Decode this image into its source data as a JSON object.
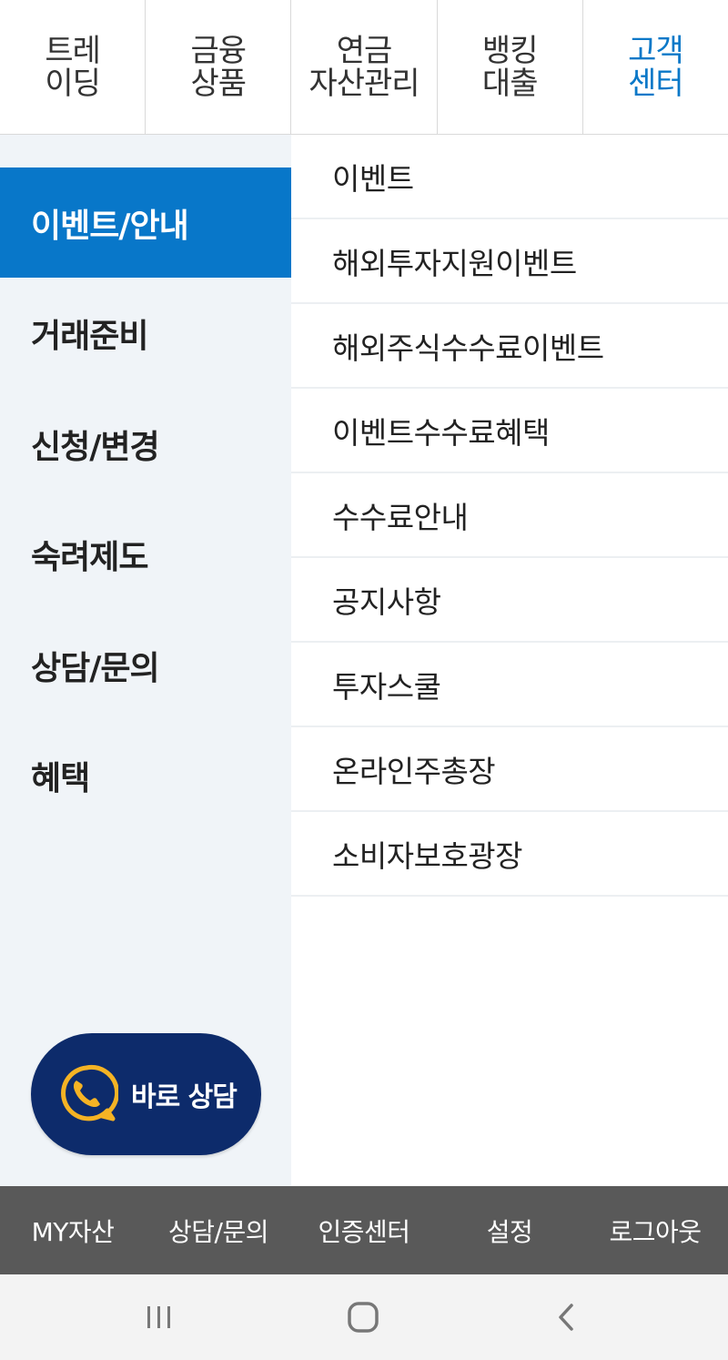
{
  "top_tabs": [
    {
      "line1": "트레",
      "line2": "이딩"
    },
    {
      "line1": "금융",
      "line2": "상품"
    },
    {
      "line1": "연금",
      "line2": "자산관리"
    },
    {
      "line1": "뱅킹",
      "line2": "대출"
    },
    {
      "line1": "고객",
      "line2": "센터"
    }
  ],
  "sidebar": {
    "items": [
      {
        "label": "이벤트/안내"
      },
      {
        "label": "거래준비"
      },
      {
        "label": "신청/변경"
      },
      {
        "label": "숙려제도"
      },
      {
        "label": "상담/문의"
      },
      {
        "label": "혜택"
      }
    ],
    "consult_button": {
      "label": "바로 상담",
      "icon": "phone-chat-icon"
    }
  },
  "submenu": {
    "items": [
      {
        "label": "이벤트"
      },
      {
        "label": "해외투자지원이벤트"
      },
      {
        "label": "해외주식수수료이벤트"
      },
      {
        "label": "이벤트수수료혜택"
      },
      {
        "label": "수수료안내"
      },
      {
        "label": "공지사항"
      },
      {
        "label": "투자스쿨"
      },
      {
        "label": "온라인주총장"
      },
      {
        "label": "소비자보호광장"
      }
    ]
  },
  "bottom_bar": {
    "items": [
      {
        "label": "MY자산"
      },
      {
        "label": "상담/문의"
      },
      {
        "label": "인증센터"
      },
      {
        "label": "설정"
      },
      {
        "label": "로그아웃"
      }
    ]
  },
  "system_nav": {
    "recent": "recent-apps-icon",
    "home": "home-icon",
    "back": "back-icon"
  },
  "colors": {
    "accent": "#0877c9",
    "consult_bg": "#0d2b6b",
    "consult_icon": "#f5b324",
    "sidebar_bg": "#f0f4f8",
    "bottom_bar_bg": "#595959"
  }
}
